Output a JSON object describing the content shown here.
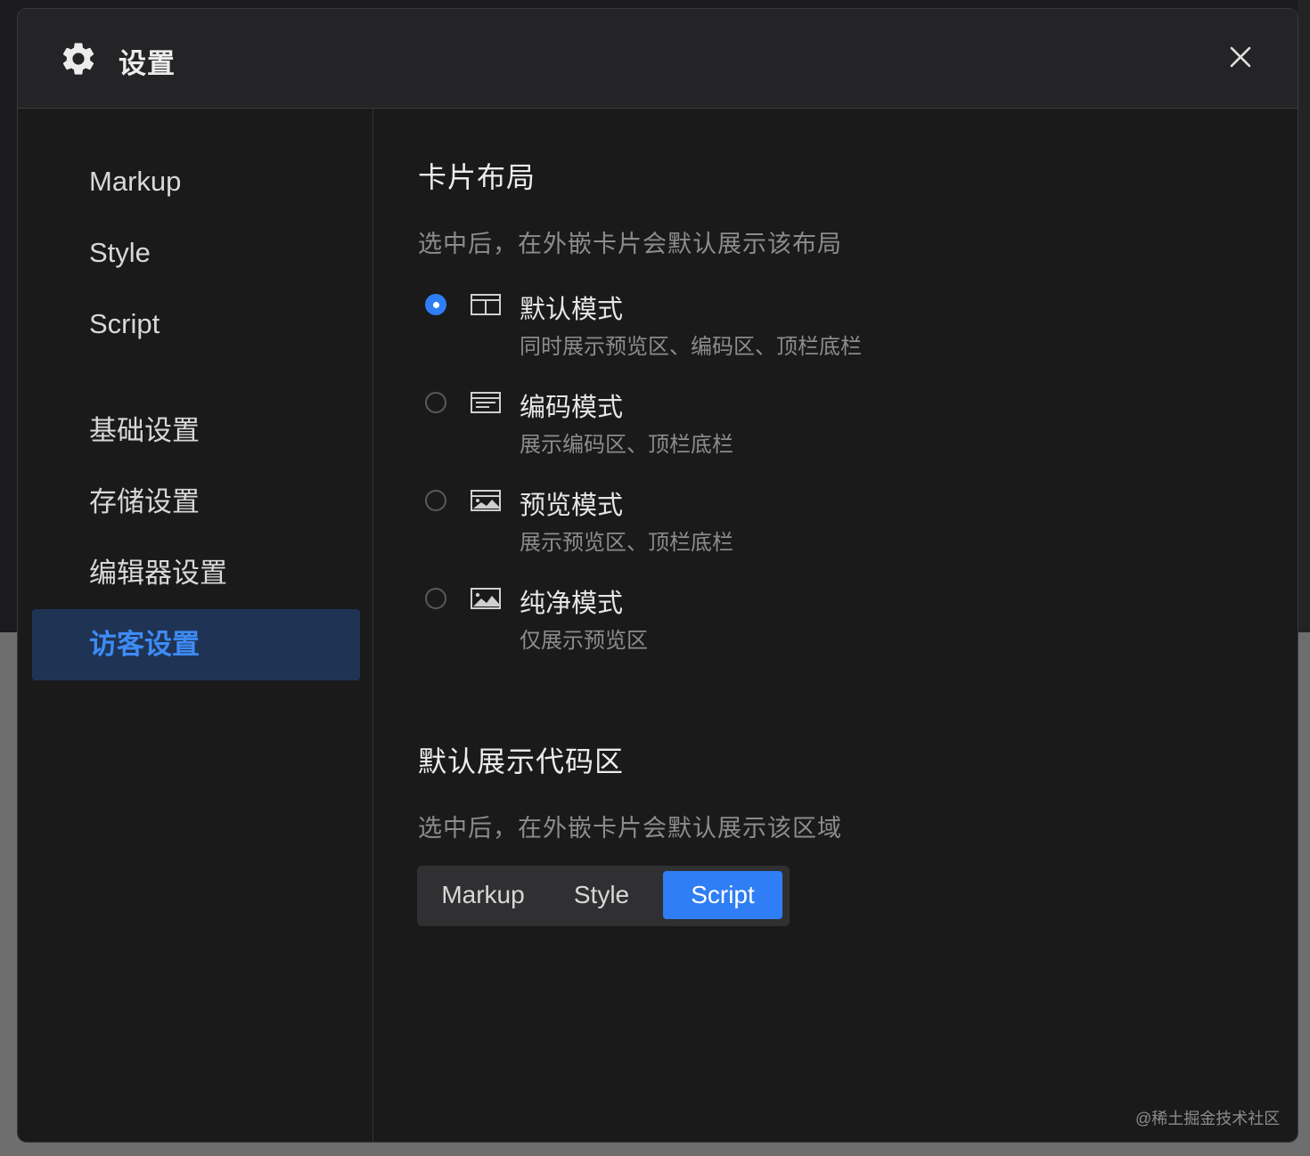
{
  "dialog": {
    "title": "设置",
    "watermark": "@稀土掘金技术社区"
  },
  "sidebar": {
    "items": [
      {
        "label": "Markup"
      },
      {
        "label": "Style"
      },
      {
        "label": "Script"
      },
      {
        "label": "基础设置"
      },
      {
        "label": "存储设置"
      },
      {
        "label": "编辑器设置"
      },
      {
        "label": "访客设置",
        "active": true
      }
    ]
  },
  "layout_section": {
    "title": "卡片布局",
    "description": "选中后，在外嵌卡片会默认展示该布局",
    "options": [
      {
        "title": "默认模式",
        "desc": "同时展示预览区、编码区、顶栏底栏",
        "icon": "split-pane-icon",
        "checked": true
      },
      {
        "title": "编码模式",
        "desc": "展示编码区、顶栏底栏",
        "icon": "code-lines-icon",
        "checked": false
      },
      {
        "title": "预览模式",
        "desc": "展示预览区、顶栏底栏",
        "icon": "image-icon",
        "checked": false
      },
      {
        "title": "纯净模式",
        "desc": "仅展示预览区",
        "icon": "image-icon",
        "checked": false
      }
    ]
  },
  "code_section": {
    "title": "默认展示代码区",
    "description": "选中后，在外嵌卡片会默认展示该区域",
    "tabs": [
      {
        "label": "Markup",
        "active": false
      },
      {
        "label": "Style",
        "active": false
      },
      {
        "label": "Script",
        "active": true
      }
    ]
  },
  "colors": {
    "accent": "#2f7ef6",
    "active_nav_bg": "#1f3454",
    "active_nav_text": "#3d8bf5"
  }
}
